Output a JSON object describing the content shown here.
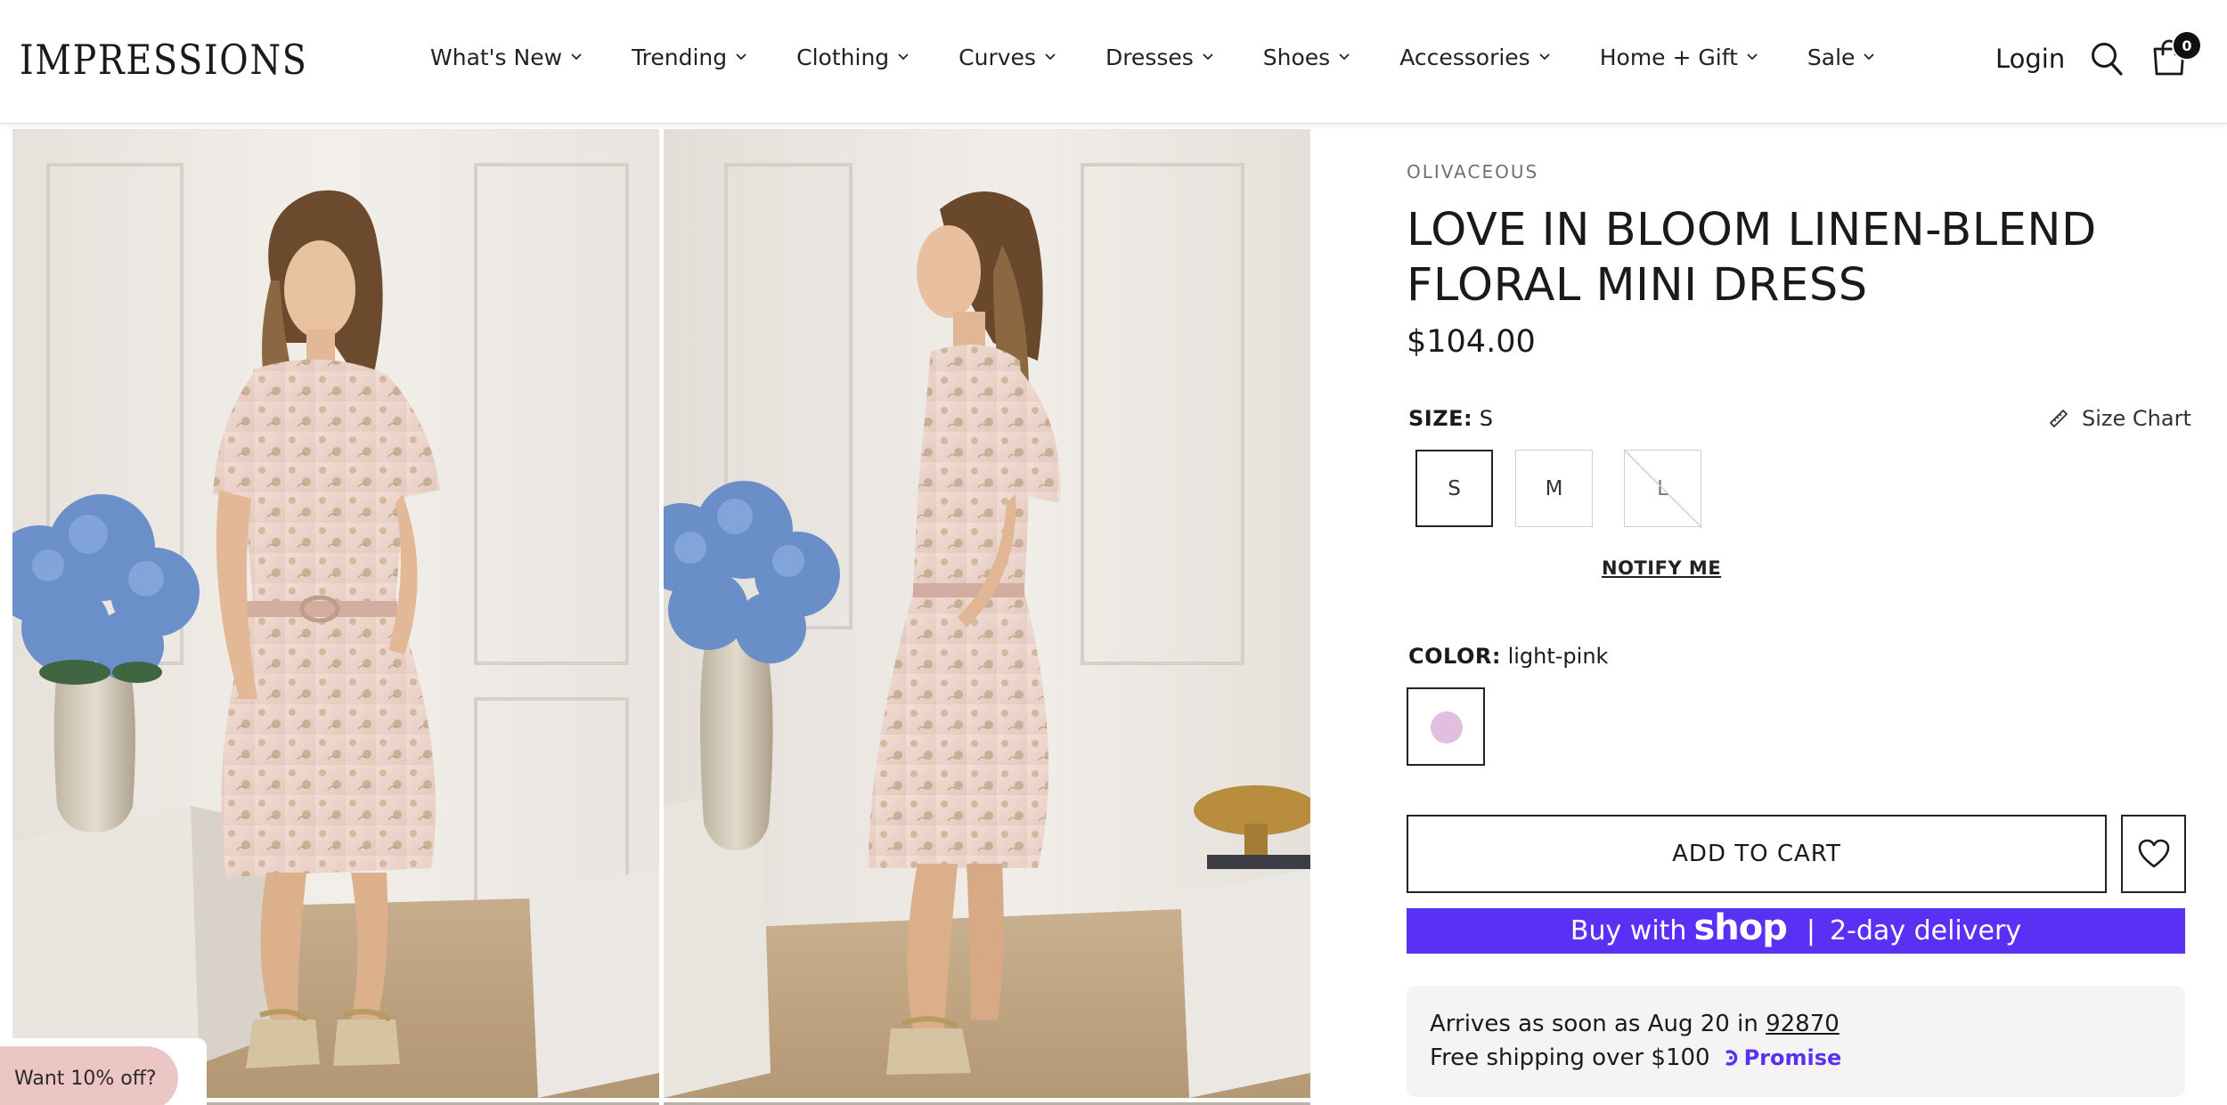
{
  "header": {
    "logo": "IMPRESSIONS",
    "nav": [
      "What's New",
      "Trending",
      "Clothing",
      "Curves",
      "Dresses",
      "Shoes",
      "Accessories",
      "Home + Gift",
      "Sale"
    ],
    "login": "Login",
    "cart_count": "0",
    "icons": {
      "search": "search-icon",
      "cart": "shopping-bag-icon",
      "chevron": "chevron-down-icon"
    }
  },
  "promo": {
    "label": "Want 10% off?"
  },
  "product": {
    "brand": "OLIVACEOUS",
    "title": "LOVE IN BLOOM LINEN-BLEND FLORAL MINI DRESS",
    "price": "$104.00",
    "size": {
      "label": "SIZE:",
      "selected": "S",
      "chart_label": "Size Chart",
      "options": [
        {
          "label": "S",
          "state": "selected"
        },
        {
          "label": "M",
          "state": "available"
        },
        {
          "label": "L",
          "state": "unavailable"
        }
      ],
      "notify": "NOTIFY ME"
    },
    "color": {
      "label": "COLOR:",
      "selected": "light-pink",
      "swatch_hex": "#e3bfdf"
    },
    "add_to_cart": "ADD TO CART",
    "shop_pay": {
      "prefix": "Buy with",
      "brand": "shop",
      "separator": "|",
      "suffix": "2-day delivery",
      "color": "#5a31f4"
    },
    "promise": {
      "line1_prefix": "Arrives as soon as Aug 20 in",
      "zip": "92870",
      "line2": "Free shipping over $100",
      "brand": "Promise",
      "brand_color": "#5a31f4"
    }
  }
}
